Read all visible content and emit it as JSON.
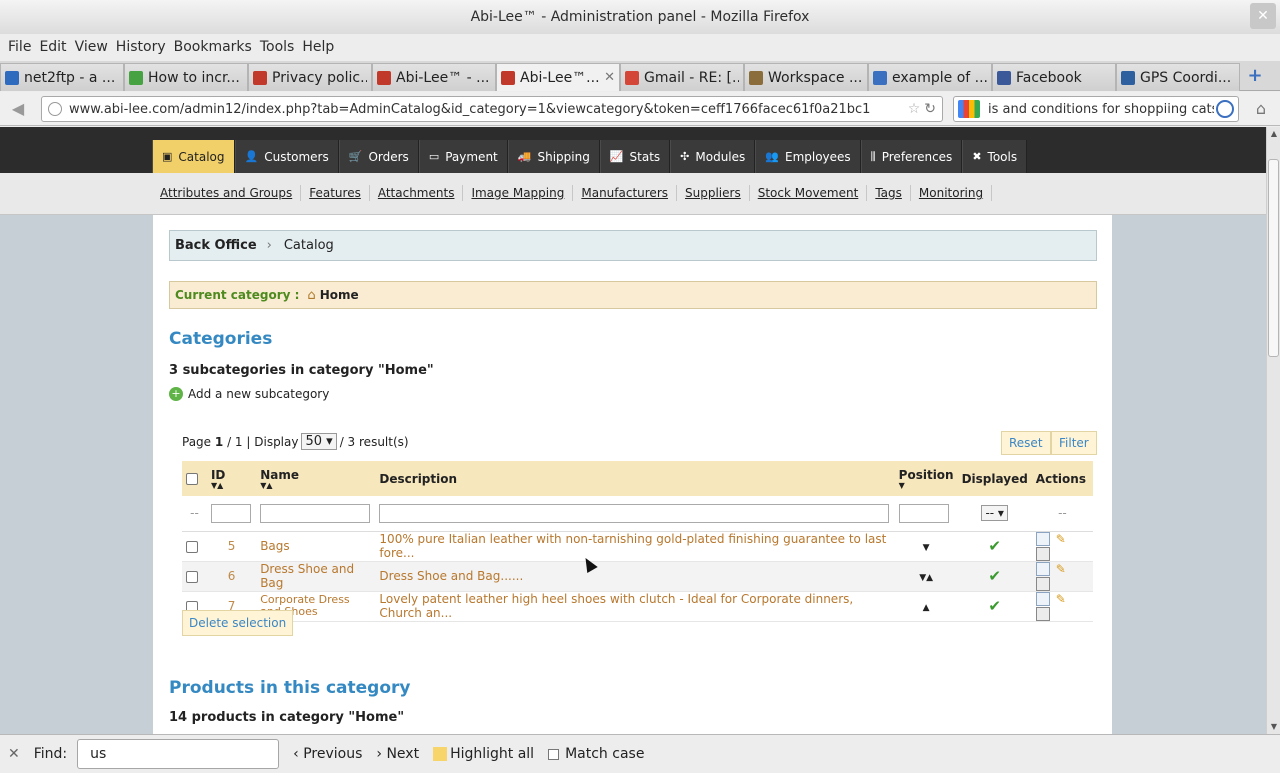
{
  "window": {
    "title": "Abi-Lee™ - Administration panel - Mozilla Firefox",
    "close": "✕"
  },
  "menu": [
    "File",
    "Edit",
    "View",
    "History",
    "Bookmarks",
    "Tools",
    "Help"
  ],
  "tabs": [
    {
      "label": "net2ftp - a ...",
      "icon_color": "#2e6bbf"
    },
    {
      "label": "How to incr...",
      "icon_color": "#47a341"
    },
    {
      "label": "Privacy polic...",
      "icon_color": "#c0392b"
    },
    {
      "label": "Abi-Lee™ - ...",
      "icon_color": "#c0392b"
    },
    {
      "label": "Abi-Lee™...",
      "icon_color": "#c0392b",
      "close": "✕"
    },
    {
      "label": "Gmail - RE: [...",
      "icon_color": "#d44638"
    },
    {
      "label": "Workspace ...",
      "icon_color": "#8a6d3b"
    },
    {
      "label": "example of ...",
      "icon_color": "#3b6fbf"
    },
    {
      "label": "Facebook",
      "icon_color": "#3b5998"
    },
    {
      "label": "GPS Coordi...",
      "icon_color": "#2e5f9e"
    }
  ],
  "navbar": {
    "url": "www.abi-lee.com/admin12/index.php?tab=AdminCatalog&id_category=1&viewcategory&token=ceff1766facec61f0a21bc1",
    "search": "is and conditions for shoppiing cats"
  },
  "admin": {
    "main_nav": [
      {
        "label": "Catalog",
        "icon": "▣",
        "active": true
      },
      {
        "label": "Customers",
        "icon": "👤"
      },
      {
        "label": "Orders",
        "icon": "🛒"
      },
      {
        "label": "Payment",
        "icon": "▭"
      },
      {
        "label": "Shipping",
        "icon": "🚚"
      },
      {
        "label": "Stats",
        "icon": "📈"
      },
      {
        "label": "Modules",
        "icon": "✣"
      },
      {
        "label": "Employees",
        "icon": "👥"
      },
      {
        "label": "Preferences",
        "icon": "⫼"
      },
      {
        "label": "Tools",
        "icon": "✖"
      }
    ],
    "sub_nav": [
      "Attributes and Groups",
      "Features",
      "Attachments",
      "Image Mapping",
      "Manufacturers",
      "Suppliers",
      "Stock Movement",
      "Tags",
      "Monitoring"
    ],
    "breadcrumb": {
      "root": "Back Office",
      "sep": "›",
      "current": "Catalog"
    },
    "current_category": {
      "label": "Current category :",
      "value": "Home"
    },
    "categories_title": "Categories",
    "subcategory_count": "3 subcategories in category \"Home\"",
    "add_subcategory": "Add a new subcategory",
    "pager": {
      "page_prefix": "Page",
      "page": "1",
      "total_pages": "/ 1 | Display",
      "per_page": "50",
      "results": "/ 3 result(s)"
    },
    "reset": "Reset",
    "filter": "Filter",
    "columns": {
      "id": "ID",
      "name": "Name",
      "description": "Description",
      "position": "Position",
      "displayed": "Displayed",
      "actions": "Actions"
    },
    "filter_placeholder": "--",
    "displayed_select": "--",
    "rows": [
      {
        "id": "5",
        "name": "Bags",
        "description": "100% pure Italian leather with non-tarnishing gold-plated finishing guarantee to last fore...",
        "position": "▼"
      },
      {
        "id": "6",
        "name": "Dress Shoe and Bag",
        "description": "Dress Shoe and Bag......",
        "position": "▼▲"
      },
      {
        "id": "7",
        "name": "Corporate Dress and Shoes",
        "description": "Lovely patent leather high heel shoes with clutch - Ideal for Corporate dinners, Church an...",
        "position": "▲"
      }
    ],
    "delete_selection": "Delete selection",
    "products_title": "Products in this category",
    "products_count": "14 products in category \"Home\""
  },
  "findbar": {
    "label": "Find:",
    "value": "us",
    "previous": "Previous",
    "next": "Next",
    "highlight": "Highlight all",
    "match_case": "Match case"
  }
}
